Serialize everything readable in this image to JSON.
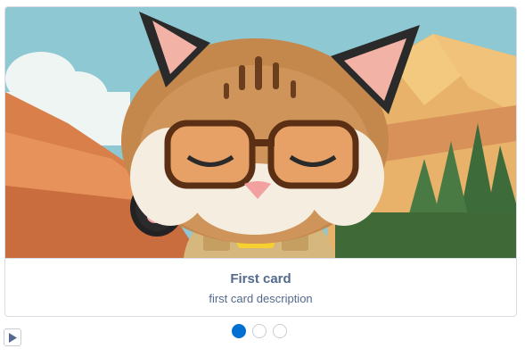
{
  "carousel": {
    "active_index": 0,
    "panels": [
      {
        "title": "First card",
        "description": "first card description"
      },
      {
        "title": "",
        "description": ""
      },
      {
        "title": "",
        "description": ""
      }
    ]
  },
  "indicators": [
    {
      "state": "active"
    },
    {
      "state": "inactive"
    },
    {
      "state": "inactive"
    }
  ],
  "colors": {
    "active_dot": "#0070d2",
    "text": "#54698d",
    "border": "#d8dde6"
  },
  "icons": {
    "autoplay": "play-icon"
  }
}
